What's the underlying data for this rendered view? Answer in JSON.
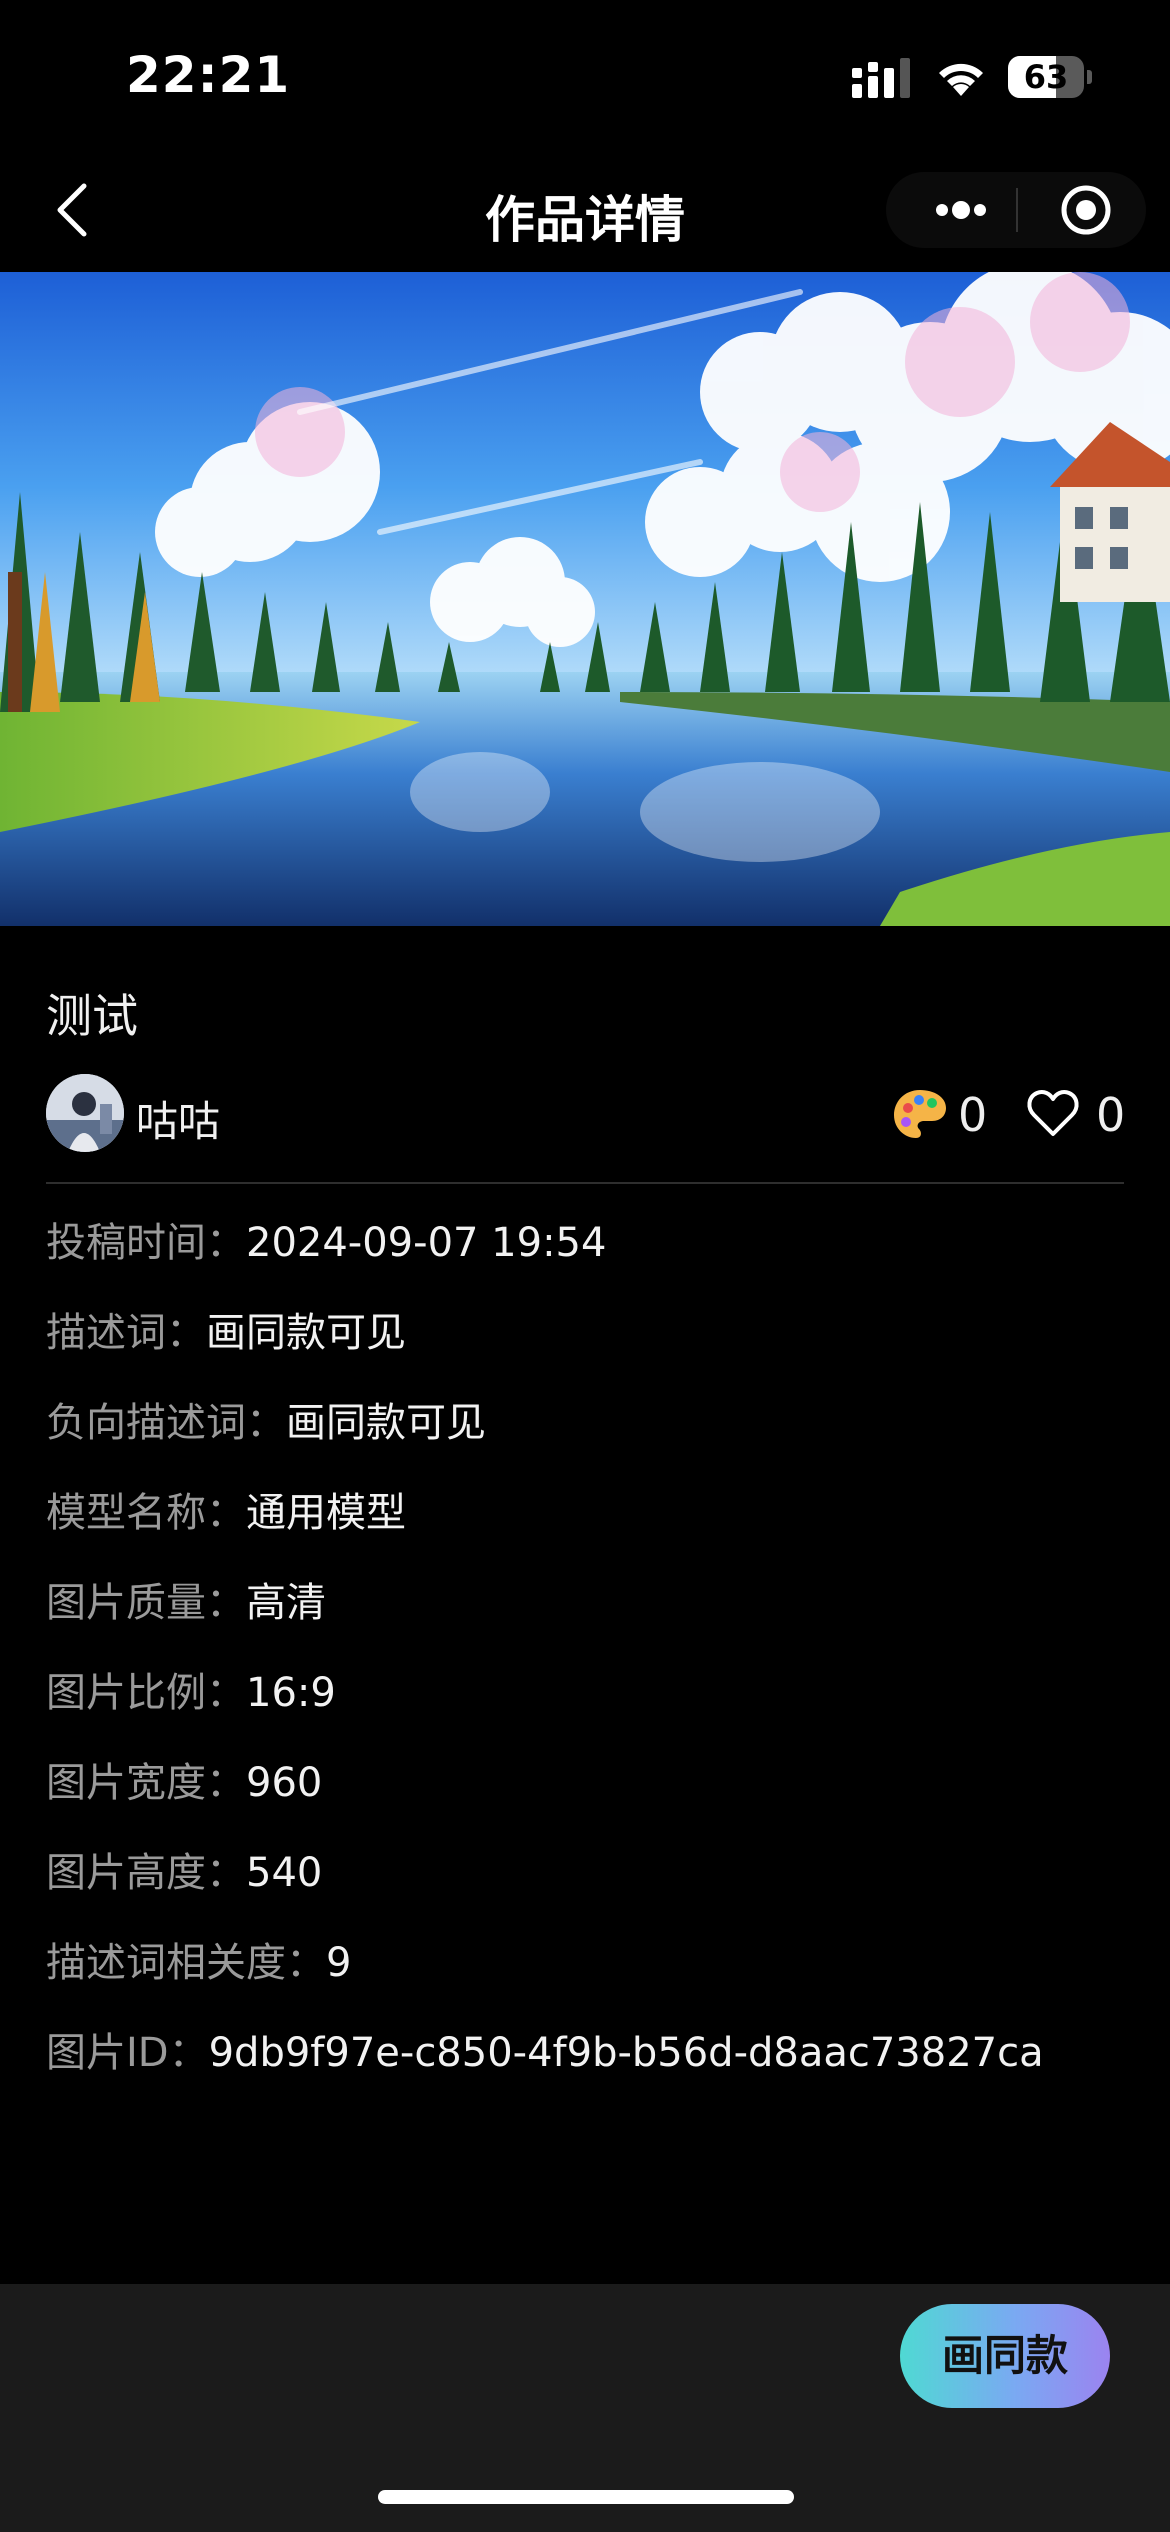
{
  "status_bar": {
    "time": "22:21",
    "battery": "63",
    "battery_level": 0.63,
    "icons": [
      "signal-icon",
      "wifi-icon",
      "battery-icon"
    ]
  },
  "nav": {
    "title": "作品详情",
    "icons": [
      "back-arrow-icon",
      "more-dots-icon",
      "target-circle-icon"
    ]
  },
  "artwork": {
    "description_icon": "landscape-image"
  },
  "work": {
    "title": "测试",
    "author": "咕咕",
    "remix_count": "0",
    "like_count": "0"
  },
  "details": [
    {
      "label": "投稿时间：",
      "value": "2024-09-07 19:54"
    },
    {
      "label": "描述词：",
      "value": "画同款可见"
    },
    {
      "label": "负向描述词：",
      "value": "画同款可见"
    },
    {
      "label": "模型名称：",
      "value": "通用模型"
    },
    {
      "label": "图片质量：",
      "value": "高清"
    },
    {
      "label": "图片比例：",
      "value": "16:9"
    },
    {
      "label": "图片宽度：",
      "value": "960"
    },
    {
      "label": "图片高度：",
      "value": "540"
    },
    {
      "label": "描述词相关度：",
      "value": "9"
    },
    {
      "label": "图片ID：",
      "value": "9db9f97e-c850-4f9b-b56d-d8aac73827ca"
    }
  ],
  "bottom": {
    "draw_same_label": "画同款"
  },
  "colors": {
    "background": "#000000",
    "bottom_bar": "#1b1b1b",
    "label_gray": "#9a9a9a",
    "button_gradient_start": "#4fd9d3",
    "button_gradient_end": "#9b83f0"
  }
}
